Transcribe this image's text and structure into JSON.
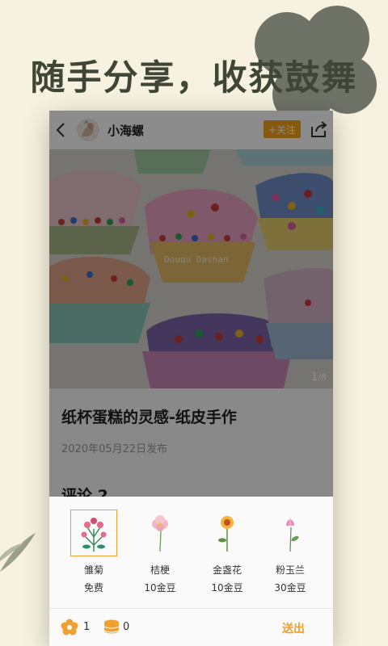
{
  "headline": "随手分享，收获鼓舞",
  "post": {
    "username": "小海螺",
    "follow_label": "+关注",
    "watermark": "Douqu Dashan",
    "page_current": "1",
    "page_total": "/8",
    "title": "纸杯蛋糕的灵感-纸皮手作",
    "date": "2020年05月22日发布",
    "comments_heading": "评论 2"
  },
  "gifts": [
    {
      "name": "雏菊",
      "price": "免费",
      "selected": true,
      "icon": "daisy-bouquet-icon"
    },
    {
      "name": "桔梗",
      "price": "10金豆",
      "selected": false,
      "icon": "bellflower-icon"
    },
    {
      "name": "金盏花",
      "price": "10金豆",
      "selected": false,
      "icon": "marigold-icon"
    },
    {
      "name": "粉玉兰",
      "price": "30金豆",
      "selected": false,
      "icon": "pink-magnolia-icon"
    }
  ],
  "footer": {
    "flower_count": "1",
    "coin_count": "0",
    "send_label": "送出"
  },
  "colors": {
    "background": "#f7f1df",
    "headline": "#3f4637",
    "accent": "#f3a21d",
    "blob": "#6f7266"
  }
}
